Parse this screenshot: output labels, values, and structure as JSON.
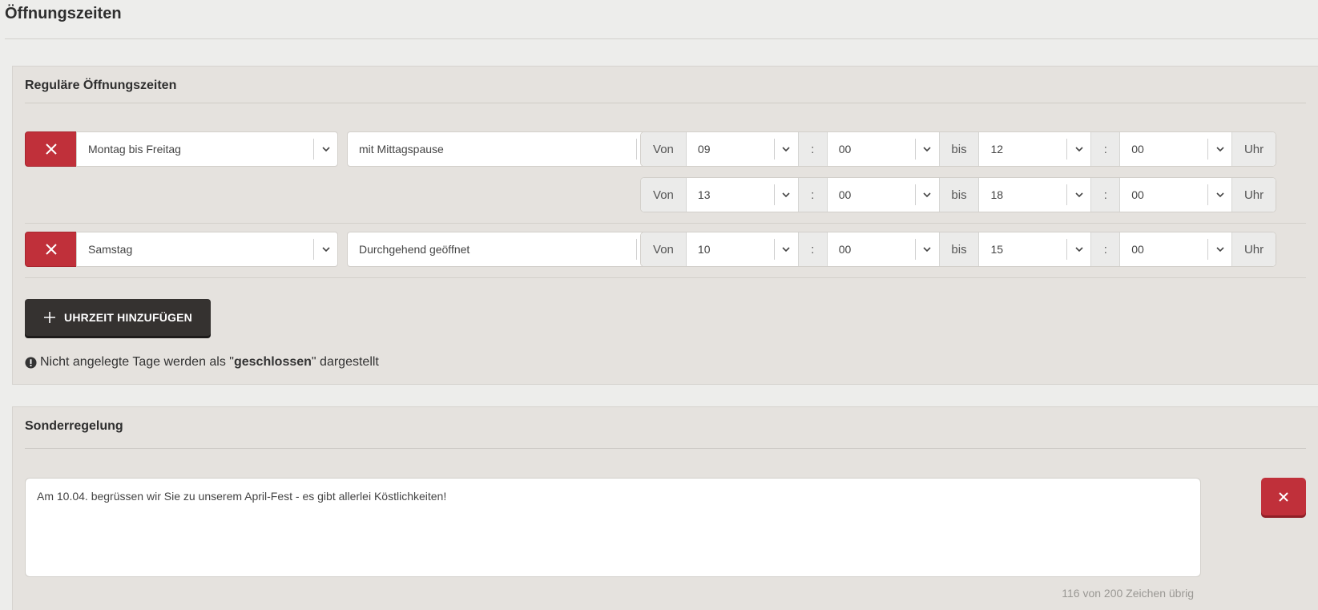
{
  "page": {
    "title": "Öffnungszeiten"
  },
  "regular": {
    "heading": "Reguläre Öffnungszeiten",
    "rows": [
      {
        "day": "Montag bis Freitag",
        "mode": "mit Mittagspause",
        "slots": [
          {
            "von_label": "Von",
            "from_h": "09",
            "colon": ":",
            "from_m": "00",
            "bis_label": "bis",
            "to_h": "12",
            "to_m": "00",
            "uhr_label": "Uhr"
          },
          {
            "von_label": "Von",
            "from_h": "13",
            "colon": ":",
            "from_m": "00",
            "bis_label": "bis",
            "to_h": "18",
            "to_m": "00",
            "uhr_label": "Uhr"
          }
        ]
      },
      {
        "day": "Samstag",
        "mode": "Durchgehend geöffnet",
        "slots": [
          {
            "von_label": "Von",
            "from_h": "10",
            "colon": ":",
            "from_m": "00",
            "bis_label": "bis",
            "to_h": "15",
            "to_m": "00",
            "uhr_label": "Uhr"
          }
        ]
      }
    ],
    "add_button_label": "UHRZEIT HINZUFÜGEN",
    "notice": {
      "before": "Nicht angelegte Tage werden als \"",
      "bold": "geschlossen",
      "after": "\" dargestellt"
    }
  },
  "special": {
    "heading": "Sonderregelung",
    "text": "Am 10.04. begrüssen wir Sie zu unserem April-Fest - es gibt allerlei Köstlichkeiten!",
    "counter": "116 von 200 Zeichen übrig"
  },
  "icons": {
    "delete": "close-icon",
    "dropdown": "chevron-down-icon",
    "add": "plus-icon",
    "notice": "exclamation-circle-icon"
  },
  "colors": {
    "danger": "#c0303a",
    "dark_button": "#353230",
    "panel_bg": "#e5e2de",
    "page_bg": "#ededeb"
  }
}
